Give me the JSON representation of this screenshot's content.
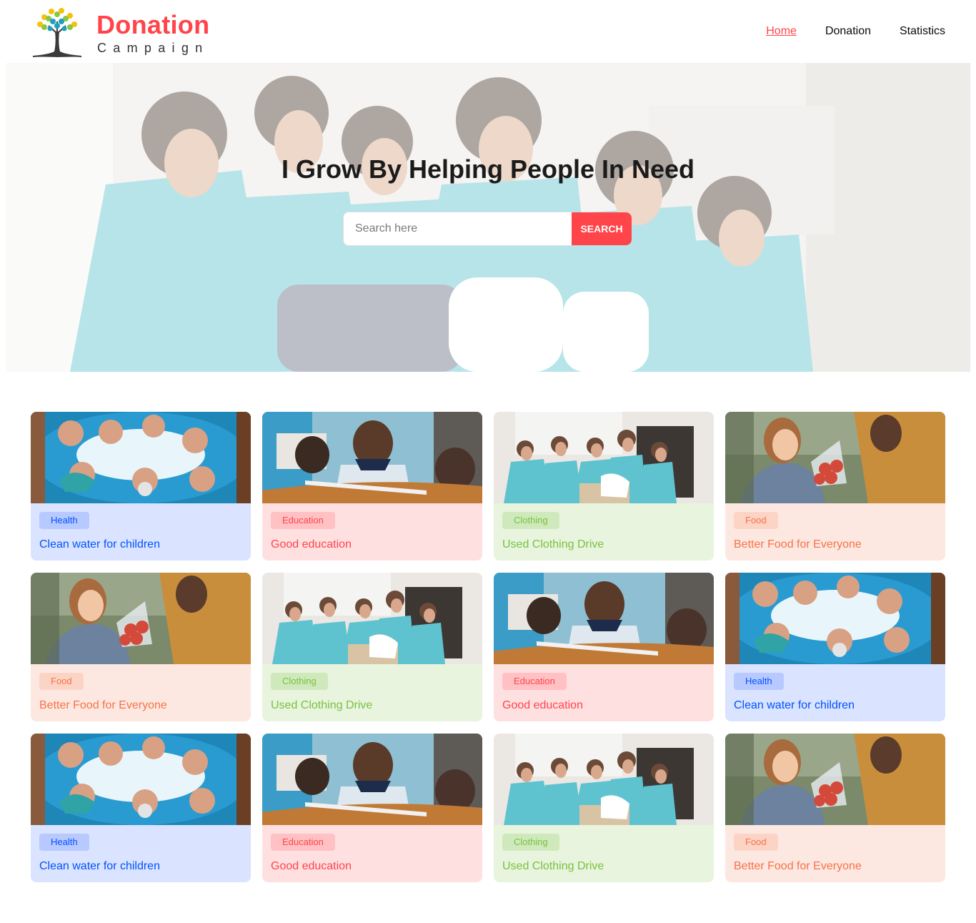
{
  "header": {
    "brand_name": "Donation",
    "brand_sub": "Campaign",
    "nav": [
      {
        "label": "Home",
        "active": true
      },
      {
        "label": "Donation",
        "active": false
      },
      {
        "label": "Statistics",
        "active": false
      }
    ]
  },
  "hero": {
    "title": "I Grow By Helping People In Need",
    "search_placeholder": "Search here",
    "search_button": "SEARCH"
  },
  "cards": [
    {
      "category": "Health",
      "title": "Clean water for children",
      "theme": "health",
      "image": "volunteers-huddle"
    },
    {
      "category": "Education",
      "title": "Good education",
      "theme": "education",
      "image": "smiling-student"
    },
    {
      "category": "Clothing",
      "title": "Used Clothing Drive",
      "theme": "clothing",
      "image": "clothing-volunteers"
    },
    {
      "category": "Food",
      "title": "Better Food for Everyone",
      "theme": "food",
      "image": "girl-with-apples"
    },
    {
      "category": "Food",
      "title": "Better Food for Everyone",
      "theme": "food",
      "image": "girl-with-apples"
    },
    {
      "category": "Clothing",
      "title": "Used Clothing Drive",
      "theme": "clothing",
      "image": "clothing-volunteers"
    },
    {
      "category": "Education",
      "title": "Good education",
      "theme": "education",
      "image": "smiling-student"
    },
    {
      "category": "Health",
      "title": "Clean water for children",
      "theme": "health",
      "image": "volunteers-huddle"
    },
    {
      "category": "Health",
      "title": "Clean water for children",
      "theme": "health",
      "image": "volunteers-huddle"
    },
    {
      "category": "Education",
      "title": "Good education",
      "theme": "education",
      "image": "smiling-student"
    },
    {
      "category": "Clothing",
      "title": "Used Clothing Drive",
      "theme": "clothing",
      "image": "clothing-volunteers"
    },
    {
      "category": "Food",
      "title": "Better Food for Everyone",
      "theme": "food",
      "image": "girl-with-apples"
    }
  ],
  "colors": {
    "accent": "#ff444a",
    "health": "#0052ff",
    "education": "#ff444a",
    "clothing": "#79c23f",
    "food": "#f87147"
  }
}
